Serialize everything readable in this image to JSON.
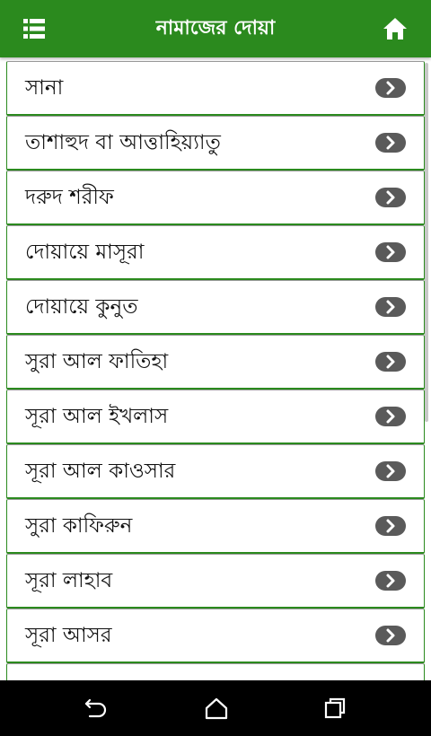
{
  "header": {
    "title": "নামাজের দোয়া",
    "menu_icon": "list-menu-icon",
    "home_icon": "home-icon"
  },
  "colors": {
    "primary": "#2b8a1e",
    "arrow_badge": "#5a5a5a",
    "navbar": "#000000"
  },
  "list": {
    "items": [
      {
        "label": "সানা"
      },
      {
        "label": "তাশাহুদ বা আত্তাহিয়্যাতু"
      },
      {
        "label": "দরুদ শরীফ"
      },
      {
        "label": "দোয়ায়ে মাসূরা"
      },
      {
        "label": "দোয়ায়ে কুনুত"
      },
      {
        "label": "সুরা আল ফাতিহা"
      },
      {
        "label": "সূরা আল ইখলাস"
      },
      {
        "label": "সূরা আল কাওসার"
      },
      {
        "label": "সুরা কাফিরুন"
      },
      {
        "label": "সূরা লাহাব"
      },
      {
        "label": "সূরা আসর"
      }
    ],
    "arrow_icon": "chevron-right-icon"
  },
  "navbar": {
    "back_icon": "back-icon",
    "home_icon": "home-outline-icon",
    "recent_icon": "recent-apps-icon"
  }
}
